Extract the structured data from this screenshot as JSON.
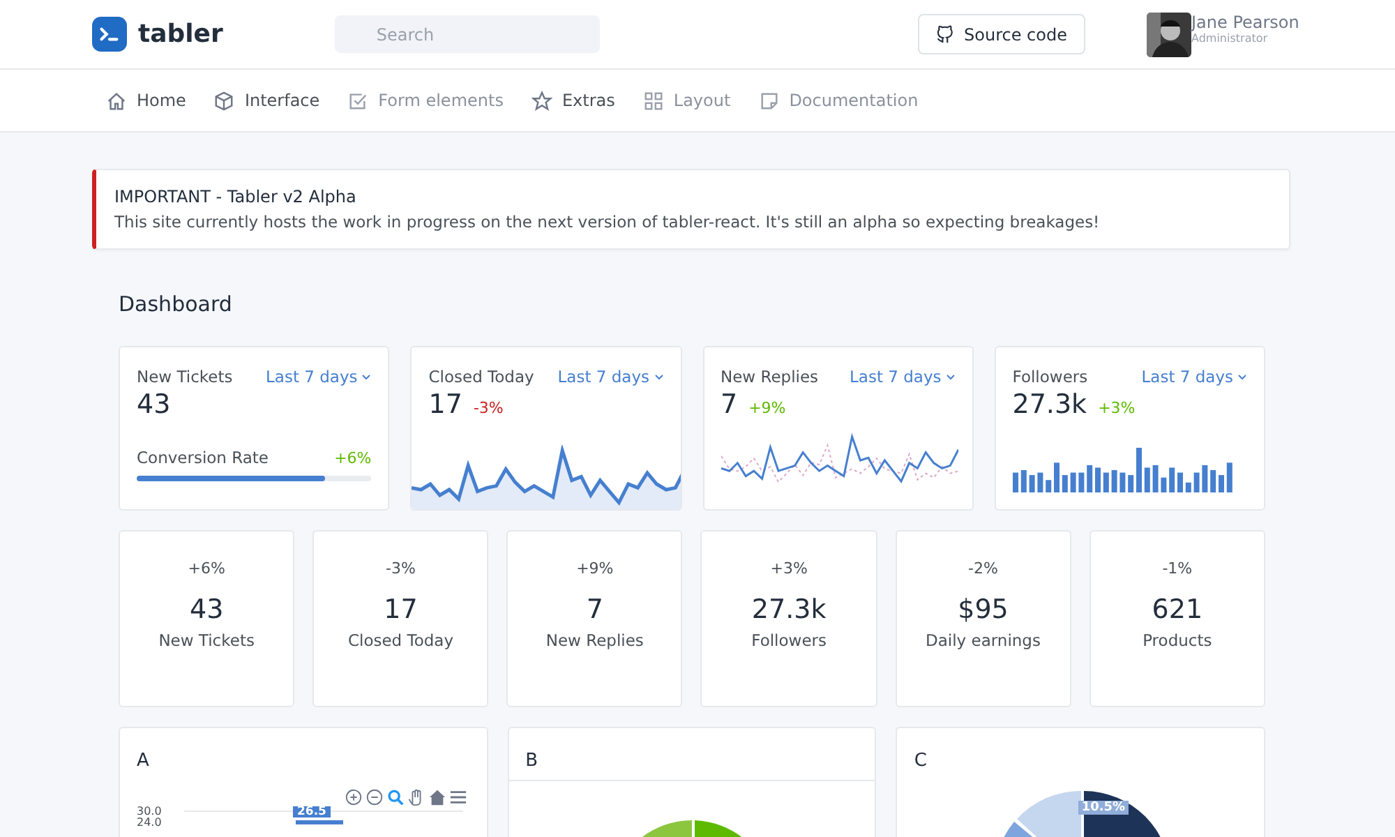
{
  "header": {
    "logo": "tabler",
    "search": {
      "placeholder": "Search"
    },
    "source_button": "Source code",
    "user": {
      "name": "Jane Pearson",
      "role": "Administrator"
    }
  },
  "nav": [
    {
      "label": "Home",
      "disabled": false
    },
    {
      "label": "Interface",
      "disabled": false
    },
    {
      "label": "Form elements",
      "disabled": true
    },
    {
      "label": "Extras",
      "disabled": false
    },
    {
      "label": "Layout",
      "disabled": true
    },
    {
      "label": "Documentation",
      "disabled": true
    }
  ],
  "alert": {
    "title": "IMPORTANT - Tabler v2 Alpha",
    "text": "This site currently hosts the work in progress on the next version of tabler-react. It's still an alpha so expecting breakages!"
  },
  "page_title": "Dashboard",
  "summary_cards": [
    {
      "kind": "progress",
      "label": "New Tickets",
      "period": "Last 7 days",
      "value": "43",
      "sub_label": "Conversion Rate",
      "delta": "+6%",
      "color": "#5eba00",
      "level": 0.8
    },
    {
      "kind": "area",
      "label": "Closed Today",
      "period": "Last 7 days",
      "value": "17",
      "delta": "-3%",
      "color": "#cd201f"
    },
    {
      "kind": "line",
      "label": "New Replies",
      "period": "Last 7 days",
      "value": "7",
      "delta": "+9%",
      "color": "#5eba00"
    },
    {
      "kind": "bars",
      "label": "Followers",
      "period": "Last 7 days",
      "value": "27.3k",
      "delta": "+3%",
      "color": "#5eba00"
    }
  ],
  "stat_cards": [
    {
      "delta": "+6%",
      "value": "43",
      "label": "New Tickets"
    },
    {
      "delta": "-3%",
      "value": "17",
      "label": "Closed Today"
    },
    {
      "delta": "+9%",
      "value": "7",
      "label": "New Replies"
    },
    {
      "delta": "+3%",
      "value": "27.3k",
      "label": "Followers"
    },
    {
      "delta": "-2%",
      "value": "$95",
      "label": "Daily earnings"
    },
    {
      "delta": "-1%",
      "value": "621",
      "label": "Products"
    }
  ],
  "chart_cards": [
    {
      "kind": "column",
      "title": "A",
      "axis_labels": [
        "30.0",
        "24.0"
      ],
      "bar_label": "26.5"
    },
    {
      "kind": "pie",
      "title": "B"
    },
    {
      "kind": "pie_slices",
      "title": "C",
      "slice_label": "10.5%"
    }
  ]
}
